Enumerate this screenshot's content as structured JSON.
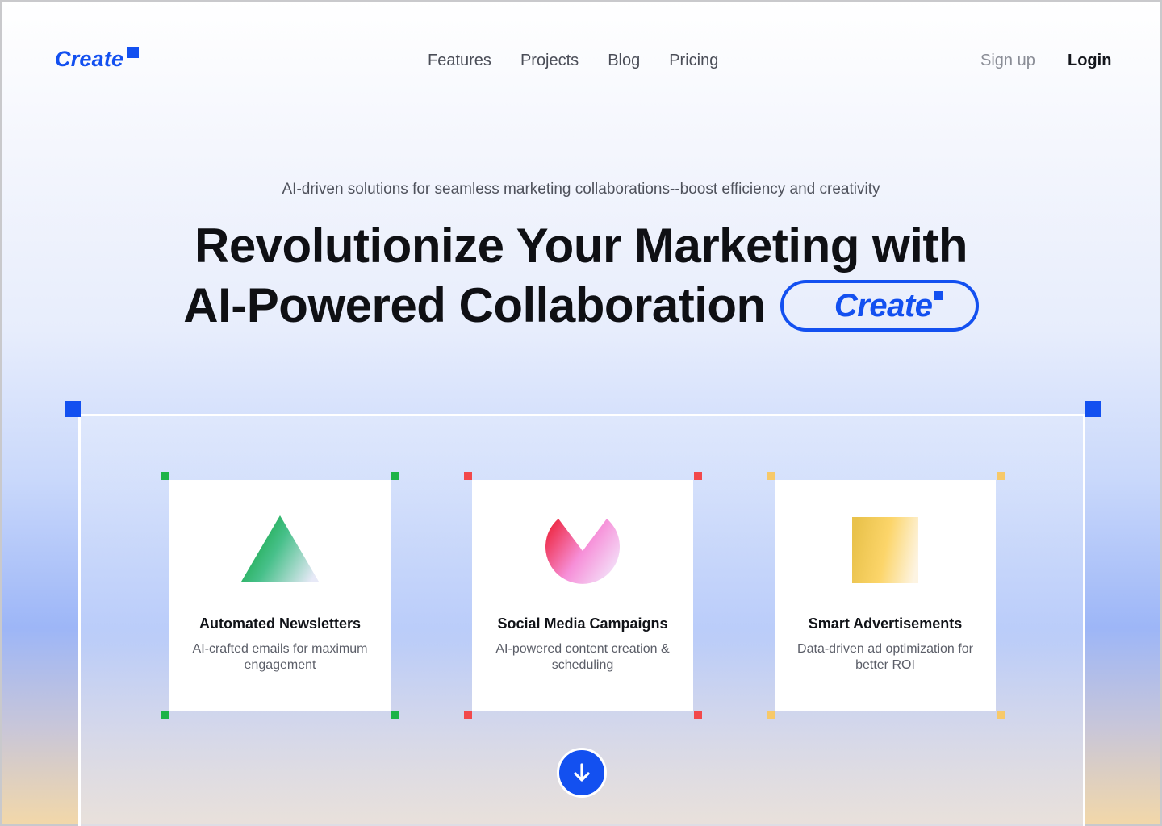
{
  "brand": {
    "name": "Create",
    "color": "#1350f0"
  },
  "nav": {
    "items": [
      "Features",
      "Projects",
      "Blog",
      "Pricing"
    ],
    "signup_label": "Sign up",
    "login_label": "Login"
  },
  "hero": {
    "subtitle": "AI-driven solutions for seamless marketing collaborations--boost efficiency and creativity",
    "headline_line1": "Revolutionize Your Marketing with",
    "headline_line2": "AI-Powered Collaboration",
    "badge_text": "Create"
  },
  "cards": [
    {
      "title": "Automated Newsletters",
      "desc": "AI-crafted emails for maximum engagement",
      "icon": "triangle-icon",
      "accent": "#1db347"
    },
    {
      "title": "Social Media Campaigns",
      "desc": "AI-powered content creation & scheduling",
      "icon": "pacman-icon",
      "accent": "#f2494b"
    },
    {
      "title": "Smart Advertisements",
      "desc": "Data-driven ad optimization for better ROI",
      "icon": "square-icon",
      "accent": "#f7c96a"
    }
  ],
  "scroll_icon": "arrow-down-icon"
}
